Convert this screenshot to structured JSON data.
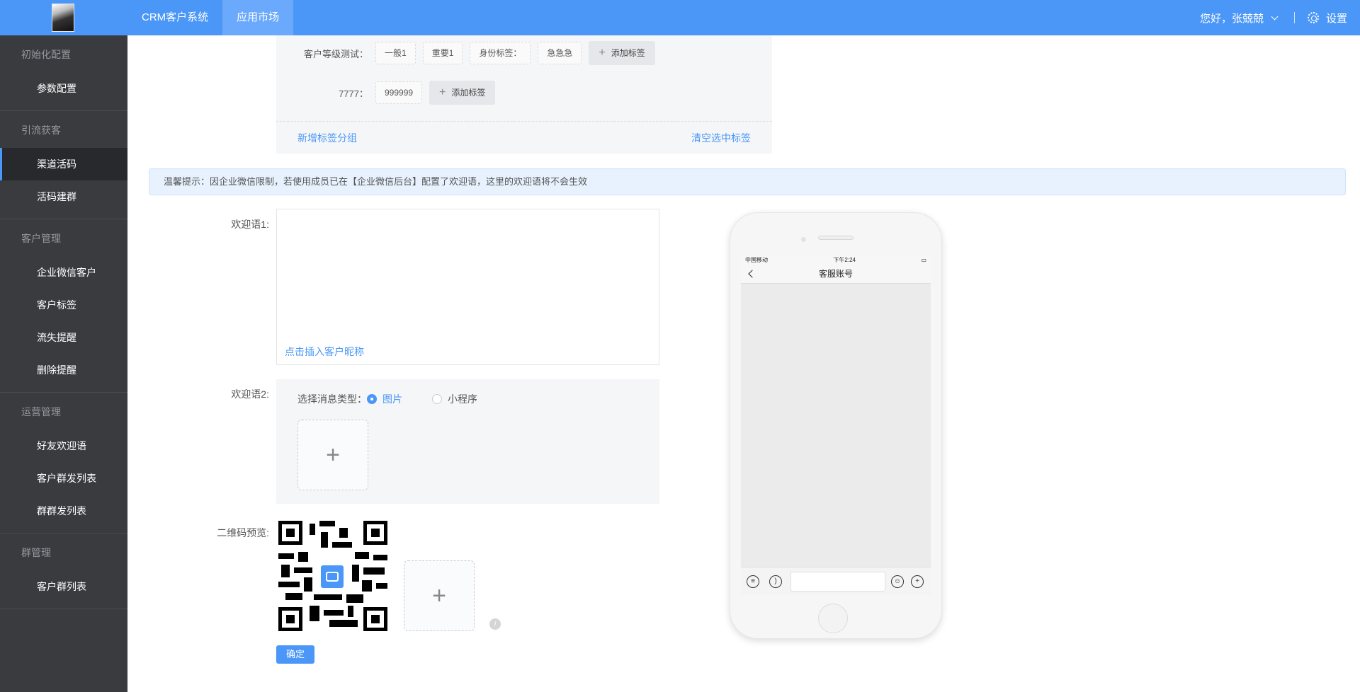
{
  "header": {
    "nav": [
      "CRM客户系统",
      "应用市场"
    ],
    "greeting": "您好，张兢兢",
    "settings_label": "设置"
  },
  "sidebar": {
    "groups": [
      {
        "title": "初始化配置",
        "items": [
          "参数配置"
        ]
      },
      {
        "title": "引流获客",
        "items": [
          "渠道活码",
          "活码建群"
        ]
      },
      {
        "title": "客户管理",
        "items": [
          "企业微信客户",
          "客户标签",
          "流失提醒",
          "删除提醒"
        ]
      },
      {
        "title": "运营管理",
        "items": [
          "好友欢迎语",
          "客户群发列表",
          "群群发列表"
        ]
      },
      {
        "title": "群管理",
        "items": [
          "客户群列表"
        ]
      }
    ],
    "active_item": "渠道活码"
  },
  "tags": {
    "rows": [
      {
        "label": "客户等级测试：",
        "tags": [
          "一般1",
          "重要1",
          "身份标签：",
          "急急急"
        ],
        "add_label": "添加标签"
      },
      {
        "label": "7777：",
        "tags": [
          "999999"
        ],
        "add_label": "添加标签"
      }
    ],
    "new_group": "新增标签分组",
    "clear_selected": "清空选中标签"
  },
  "notice": "温馨提示：因企业微信限制，若使用成员已在【企业微信后台】配置了欢迎语，这里的欢迎语将不会生效",
  "form": {
    "welcome1_label": "欢迎语1:",
    "insert_nickname": "点击插入客户昵称",
    "welcome2_label": "欢迎语2:",
    "msg_type_label": "选择消息类型：",
    "msg_types": [
      "图片",
      "小程序"
    ],
    "selected_type": "图片",
    "qr_label": "二维码预览:",
    "confirm": "确定"
  },
  "phone": {
    "carrier": "中国移动",
    "time": "下午2:24",
    "title": "客服账号"
  },
  "colors": {
    "primary": "#4b97f8",
    "sidebar_bg": "#3a3b3f"
  }
}
